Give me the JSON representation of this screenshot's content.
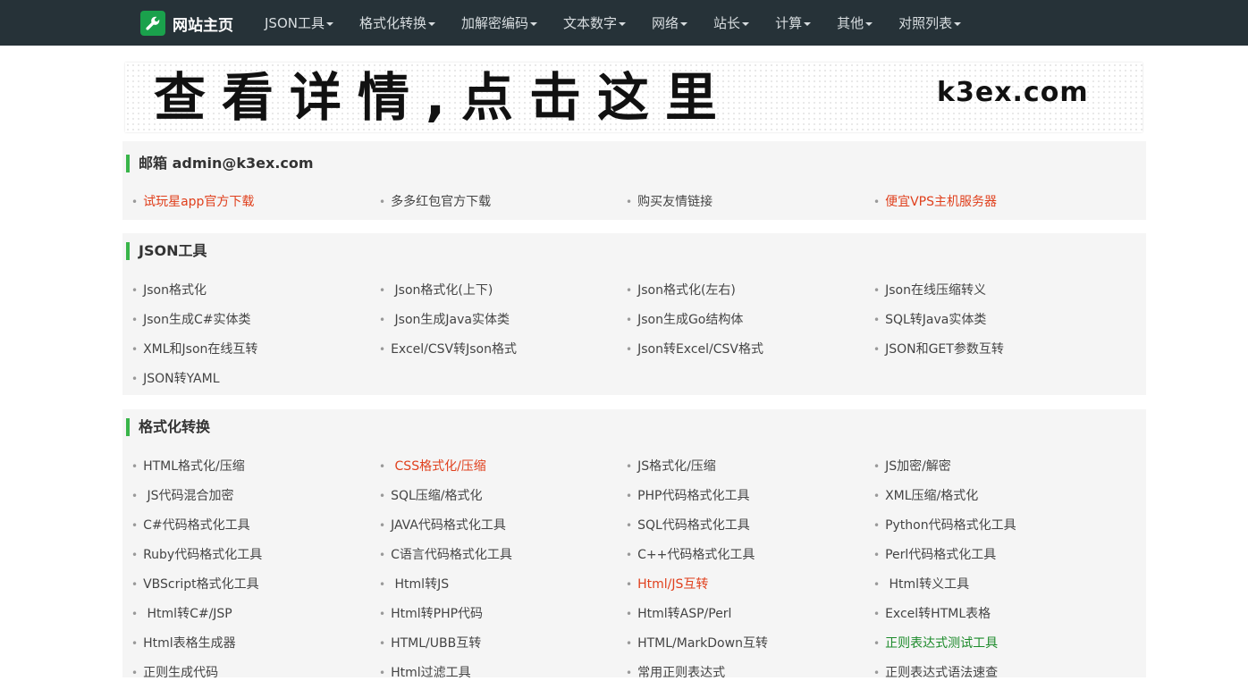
{
  "nav": {
    "brand": "网站主页",
    "menu": [
      "JSON工具",
      "格式化转换",
      "加解密编码",
      "文本数字",
      "网络",
      "站长",
      "计算",
      "其他",
      "对照列表"
    ]
  },
  "banner": {
    "text": "查看详情,点击这里",
    "site": "k3ex.com"
  },
  "sections": [
    {
      "title": "邮箱 admin@k3ex.com",
      "links": [
        {
          "label": "试玩星app官方下载",
          "color": "red"
        },
        {
          "label": "多多红包官方下载",
          "color": ""
        },
        {
          "label": "购买友情链接",
          "color": ""
        },
        {
          "label": "便宜VPS主机服务器",
          "color": "red"
        }
      ]
    },
    {
      "title": "JSON工具",
      "links": [
        {
          "label": "Json格式化",
          "color": ""
        },
        {
          "label": " Json格式化(上下)",
          "color": ""
        },
        {
          "label": "Json格式化(左右)",
          "color": ""
        },
        {
          "label": "Json在线压缩转义",
          "color": ""
        },
        {
          "label": "Json生成C#实体类",
          "color": ""
        },
        {
          "label": " Json生成Java实体类",
          "color": ""
        },
        {
          "label": "Json生成Go结构体",
          "color": ""
        },
        {
          "label": "SQL转Java实体类",
          "color": ""
        },
        {
          "label": "XML和Json在线互转",
          "color": ""
        },
        {
          "label": "Excel/CSV转Json格式",
          "color": ""
        },
        {
          "label": "Json转Excel/CSV格式",
          "color": ""
        },
        {
          "label": "JSON和GET参数互转",
          "color": ""
        },
        {
          "label": "JSON转YAML",
          "color": ""
        }
      ]
    },
    {
      "title": "格式化转换",
      "links": [
        {
          "label": "HTML格式化/压缩",
          "color": ""
        },
        {
          "label": " CSS格式化/压缩",
          "color": "red"
        },
        {
          "label": "JS格式化/压缩",
          "color": ""
        },
        {
          "label": "JS加密/解密",
          "color": ""
        },
        {
          "label": " JS代码混合加密",
          "color": ""
        },
        {
          "label": "SQL压缩/格式化",
          "color": ""
        },
        {
          "label": "PHP代码格式化工具",
          "color": ""
        },
        {
          "label": "XML压缩/格式化",
          "color": ""
        },
        {
          "label": "C#代码格式化工具",
          "color": ""
        },
        {
          "label": "JAVA代码格式化工具",
          "color": ""
        },
        {
          "label": "SQL代码格式化工具",
          "color": ""
        },
        {
          "label": "Python代码格式化工具",
          "color": ""
        },
        {
          "label": "Ruby代码格式化工具",
          "color": ""
        },
        {
          "label": "C语言代码格式化工具",
          "color": ""
        },
        {
          "label": "C++代码格式化工具",
          "color": ""
        },
        {
          "label": "Perl代码格式化工具",
          "color": ""
        },
        {
          "label": "VBScript格式化工具",
          "color": ""
        },
        {
          "label": " Html转JS",
          "color": ""
        },
        {
          "label": "Html/JS互转",
          "color": "red"
        },
        {
          "label": " Html转义工具",
          "color": ""
        },
        {
          "label": " Html转C#/JSP",
          "color": ""
        },
        {
          "label": "Html转PHP代码",
          "color": ""
        },
        {
          "label": "Html转ASP/Perl",
          "color": ""
        },
        {
          "label": "Excel转HTML表格",
          "color": ""
        },
        {
          "label": "Html表格生成器",
          "color": ""
        },
        {
          "label": "HTML/UBB互转",
          "color": ""
        },
        {
          "label": "HTML/MarkDown互转",
          "color": ""
        },
        {
          "label": "正则表达式测试工具",
          "color": "green"
        },
        {
          "label": "正则生成代码",
          "color": ""
        },
        {
          "label": "Html过滤工具",
          "color": ""
        },
        {
          "label": "常用正则表达式",
          "color": ""
        },
        {
          "label": "正则表达式语法速查",
          "color": ""
        }
      ]
    }
  ]
}
